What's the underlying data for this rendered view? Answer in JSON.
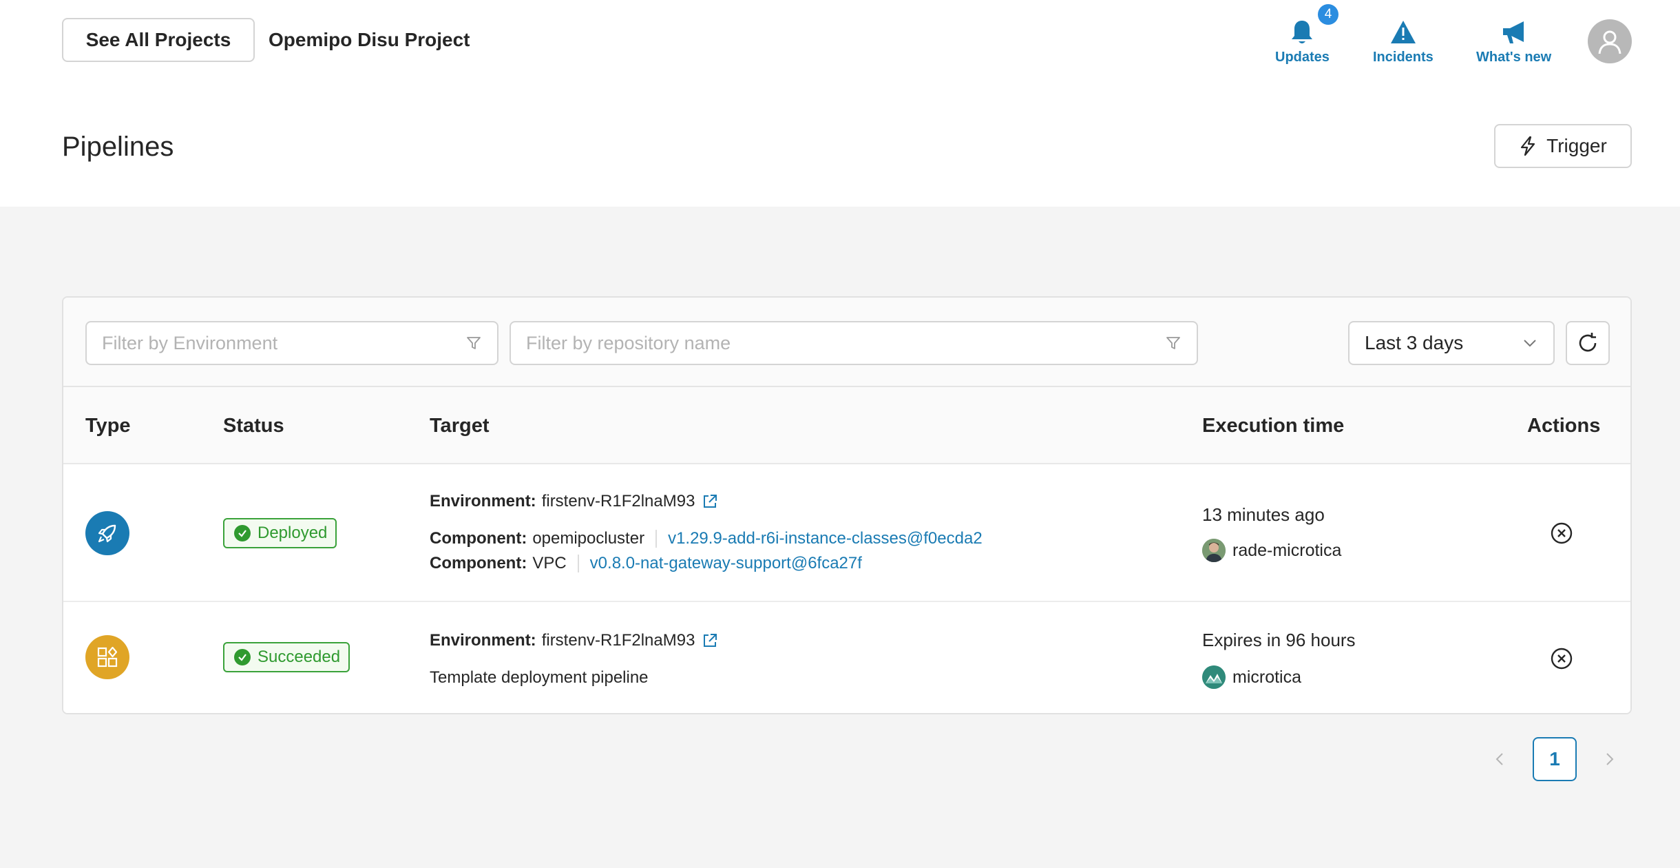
{
  "header": {
    "see_all_label": "See All Projects",
    "project_name": "Opemipo Disu Project",
    "updates_label": "Updates",
    "updates_count": "4",
    "incidents_label": "Incidents",
    "whats_new_label": "What's new"
  },
  "page": {
    "title": "Pipelines",
    "trigger_label": "Trigger"
  },
  "filters": {
    "environment_placeholder": "Filter by Environment",
    "repository_placeholder": "Filter by repository name",
    "period_value": "Last 3 days"
  },
  "table": {
    "columns": [
      "Type",
      "Status",
      "Target",
      "Execution time",
      "Actions"
    ],
    "rows": [
      {
        "type_icon": "rocket-icon",
        "status": "Deployed",
        "environment_label": "Environment:",
        "environment": "firstenv-R1F2lnaM93",
        "components": [
          {
            "label": "Component:",
            "name": "opemipocluster",
            "version": "v1.29.9-add-r6i-instance-classes@f0ecda2"
          },
          {
            "label": "Component:",
            "name": "VPC",
            "version": "v0.8.0-nat-gateway-support@6fca27f"
          }
        ],
        "execution_time": "13 minutes ago",
        "user": "rade-microtica",
        "color": "#1a7bb3"
      },
      {
        "type_icon": "template-icon",
        "status": "Succeeded",
        "environment_label": "Environment:",
        "environment": "firstenv-R1F2lnaM93",
        "description": "Template deployment pipeline",
        "execution_time": "Expires in 96 hours",
        "user": "microtica",
        "color": "#e0a526"
      }
    ]
  },
  "pagination": {
    "current_page": "1"
  },
  "colors": {
    "accent": "#1a7bb3",
    "success": "#2f9a2f",
    "badge": "#2b8de0"
  }
}
